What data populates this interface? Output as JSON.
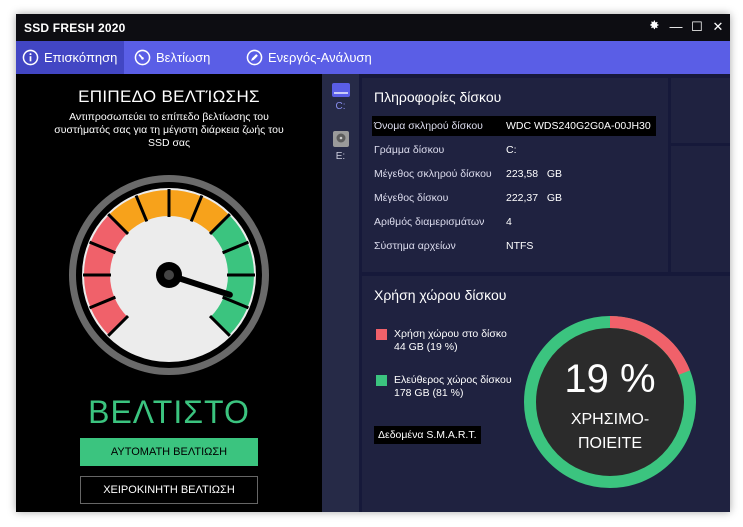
{
  "window": {
    "title": "SSD FRESH 2020"
  },
  "titlebar": {
    "settings_icon": "gear-icon",
    "minimize": "—",
    "maximize": "☐",
    "close": "✕"
  },
  "tabs": [
    {
      "label": "Επισκόπηση",
      "icon": "info-icon",
      "active": true
    },
    {
      "label": "Βελτίωση",
      "icon": "speedometer-icon",
      "active": false
    },
    {
      "label": "Ενεργός-Ανάλυση",
      "icon": "pen-icon",
      "active": false
    }
  ],
  "optimization": {
    "title": "ΕΠΙΠΕΔΟ ΒΕΛΤΊΩΣΗΣ",
    "description": "Αντιπροσωπεύει το επίπεδο βελτίωσης του συστήματός σας για τη μέγιστη διάρκεια ζωής του SSD σας",
    "status": "ΒΕΛΤΙΣΤΟ",
    "gauge_level": 0.9,
    "auto_button": "ΑΥΤΟΜΑΤΗ ΒΕΛΤΙΩΣΗ",
    "manual_button": "ΧΕΙΡΟΚΙΝΗΤΗ ΒΕΛΤΙΩΣΗ",
    "colors": {
      "red": "#f0616a",
      "orange": "#f7a21b",
      "green": "#3bc47f"
    }
  },
  "drives": [
    {
      "letter": "C:",
      "icon": "ssd-drive-icon",
      "selected": true
    },
    {
      "letter": "E:",
      "icon": "hdd-drive-icon",
      "selected": false
    }
  ],
  "disk_info": {
    "title": "Πληροφορίες δίσκου",
    "rows": [
      {
        "label": "Όνομα σκληρού δίσκου",
        "value": "WDC WDS240G2G0A-00JH30"
      },
      {
        "label": "Γράμμα δίσκου",
        "value": "C:"
      },
      {
        "label": "Μέγεθος σκληρού δίσκου",
        "value": "223,58   GB"
      },
      {
        "label": "Μέγεθος δίσκου",
        "value": "222,37   GB"
      },
      {
        "label": "Αριθμός διαμερισμάτων",
        "value": "4"
      },
      {
        "label": "Σύστημα αρχείων",
        "value": "NTFS"
      }
    ]
  },
  "usage": {
    "title": "Χρήση χώρου δίσκου",
    "used_label": "Χρήση χώρου στο δίσκο",
    "used_value": "44 GB (19 %)",
    "free_label": "Ελεύθερος χώρος δίσκου",
    "free_value": "178 GB (81 %)",
    "smart_link": "Δεδομένα S.M.A.R.T.",
    "percent_text": "19 %",
    "center_line1": "ΧΡΗΣΙΜΟ-",
    "center_line2": "ΠΟΙΕΙΤΕ",
    "used_fraction": 0.19,
    "used_color": "#f0616a",
    "free_color": "#3bc47f"
  }
}
